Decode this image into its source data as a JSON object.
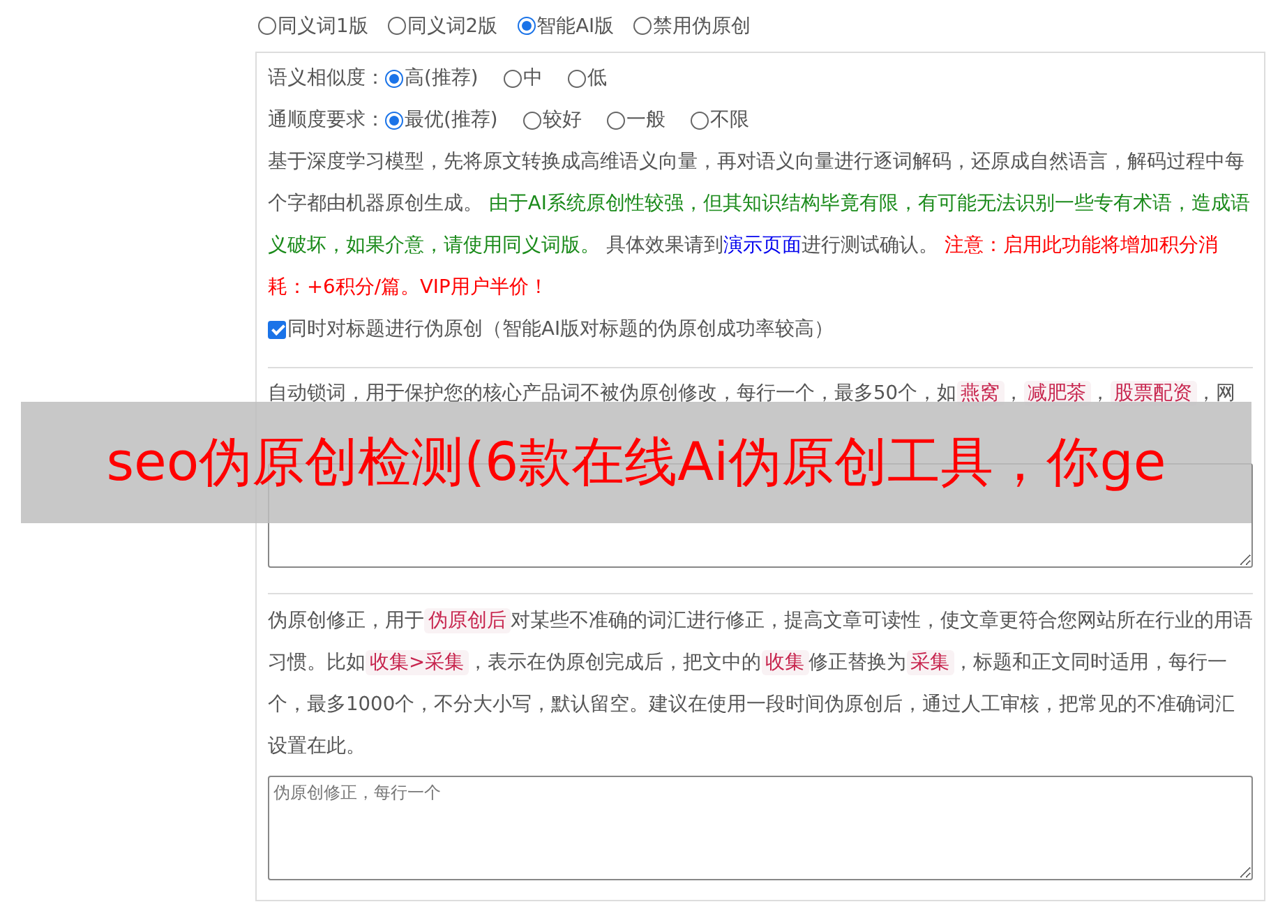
{
  "modes": [
    {
      "label": "同义词1版",
      "selected": false
    },
    {
      "label": "同义词2版",
      "selected": false
    },
    {
      "label": "智能AI版",
      "selected": true
    },
    {
      "label": "禁用伪原创",
      "selected": false
    }
  ],
  "settings": {
    "options": [
      {
        "label": "语义相似度：",
        "choices": [
          {
            "label": "高(推荐)",
            "selected": true
          },
          {
            "label": "中",
            "selected": false
          },
          {
            "label": "低",
            "selected": false
          }
        ]
      },
      {
        "label": "通顺度要求：",
        "choices": [
          {
            "label": "最优(推荐)",
            "selected": true
          },
          {
            "label": "较好",
            "selected": false
          },
          {
            "label": "一般",
            "selected": false
          },
          {
            "label": "不限",
            "selected": false
          }
        ]
      }
    ],
    "description": [
      {
        "kind": "text",
        "text": "基于深度学习模型，先将原文转换成高维语义向量，再对语义向量进行逐词解码，还原成自然语言，解码过程中每个字都由机器原创生成。 "
      },
      {
        "kind": "green",
        "text": "由于AI系统原创性较强，但其知识结构毕竟有限，有可能无法识别一些专有术语，造成语义破坏，如果介意，请使用同义词版。"
      },
      {
        "kind": "text",
        "text": " 具体效果请到"
      },
      {
        "kind": "link",
        "text": "演示页面"
      },
      {
        "kind": "text",
        "text": "进行测试确认。 "
      },
      {
        "kind": "red",
        "text": "注意：启用此功能将增加积分消耗：+6积分/篇。VIP用户半价！"
      }
    ],
    "title_option": {
      "label": "同时对标题进行伪原创（智能AI版对标题的伪原创成功率较高）",
      "checked": true
    }
  },
  "lock_words": {
    "description": [
      {
        "kind": "text",
        "text": "自动锁词，用于保护您的核心产品词不被伪原创修改，每行一个，最多50个，如"
      },
      {
        "kind": "tag",
        "text": "燕窝"
      },
      {
        "kind": "text",
        "text": "，"
      },
      {
        "kind": "tag",
        "text": "减肥茶"
      },
      {
        "kind": "text",
        "text": "，"
      },
      {
        "kind": "tag",
        "text": "股票配资"
      },
      {
        "kind": "text",
        "text": "，网"
      }
    ]
  },
  "correction": {
    "description": [
      {
        "kind": "text",
        "text": "伪原创修正，用于"
      },
      {
        "kind": "tag",
        "text": "伪原创后"
      },
      {
        "kind": "text",
        "text": "对某些不准确的词汇进行修正，提高文章可读性，使文章更符合您网站所在行业的用语习惯。比如"
      },
      {
        "kind": "tag",
        "text": "收集>采集"
      },
      {
        "kind": "text",
        "text": "，表示在伪原创完成后，把文中的"
      },
      {
        "kind": "tag",
        "text": "收集"
      },
      {
        "kind": "text",
        "text": "修正替换为"
      },
      {
        "kind": "tag",
        "text": "采集"
      },
      {
        "kind": "text",
        "text": "，标题和正文同时适用，每行一个，最多1000个，不分大小写，默认留空。建议在使用一段时间伪原创后，通过人工审核，把常见的不准确词汇设置在此。"
      }
    ],
    "placeholder": "伪原创修正，每行一个"
  },
  "overlay_banner": {
    "text": "seo伪原创检测(6款在线Ai伪原创工具，你ge"
  }
}
